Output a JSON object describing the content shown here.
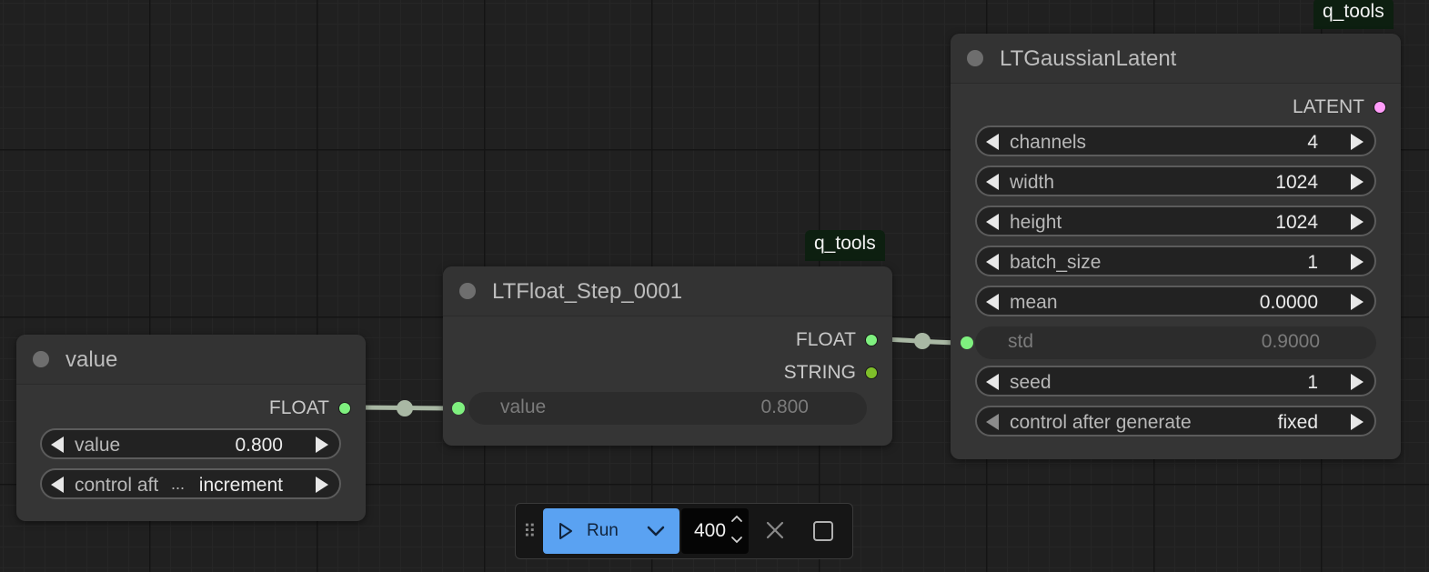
{
  "canvas": {
    "link_color": "#a9b8a4",
    "port_colors": {
      "FLOAT": "#7ff07f",
      "STRING": "#7fbf2a",
      "LATENT": "#ff9cf9"
    }
  },
  "badges": {
    "middle": "q_tools",
    "right": "q_tools"
  },
  "value_node": {
    "title": "value",
    "output": "FLOAT",
    "widgets": [
      {
        "label": "value",
        "value": "0.800"
      },
      {
        "label": "control aft",
        "ellipsis": "...",
        "value": "increment"
      }
    ]
  },
  "float_step_node": {
    "title": "LTFloat_Step_0001",
    "outputs": [
      "FLOAT",
      "STRING"
    ],
    "input_widget": {
      "label": "value",
      "value": "0.800"
    }
  },
  "gaussian_node": {
    "title": "LTGaussianLatent",
    "output": "LATENT",
    "widgets": [
      {
        "label": "channels",
        "value": "4"
      },
      {
        "label": "width",
        "value": "1024"
      },
      {
        "label": "height",
        "value": "1024"
      },
      {
        "label": "batch_size",
        "value": "1"
      },
      {
        "label": "mean",
        "value": "0.0000"
      },
      {
        "label": "std",
        "value": "0.9000"
      },
      {
        "label": "seed",
        "value": "1"
      },
      {
        "label": "control after generate",
        "value": "fixed"
      }
    ]
  },
  "run_bar": {
    "handle": "⠿",
    "run_label": "Run",
    "queue_count": "400"
  }
}
